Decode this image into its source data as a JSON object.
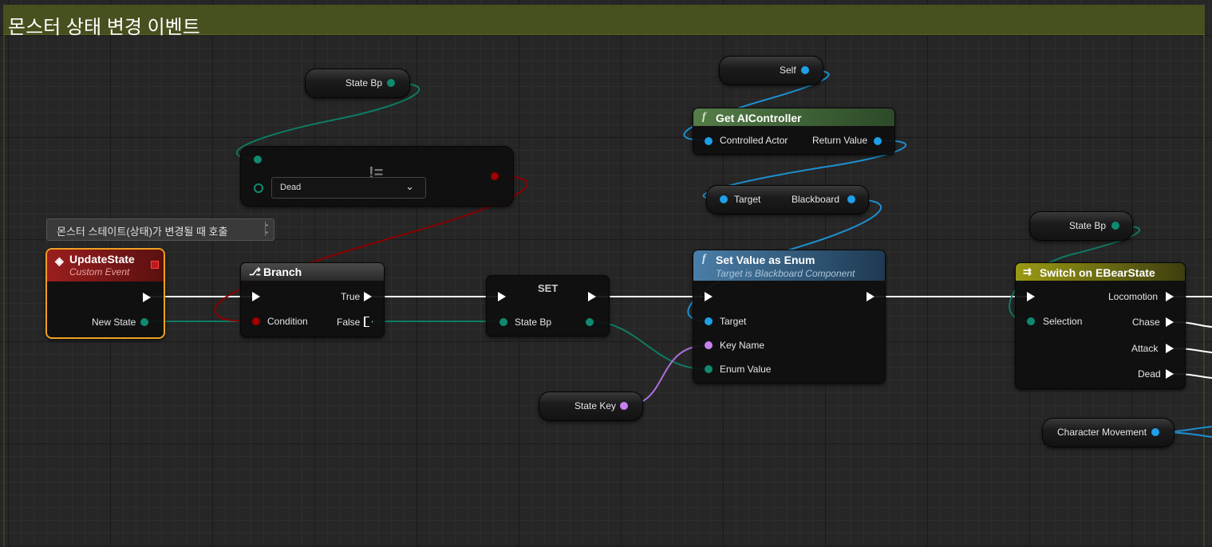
{
  "comment": {
    "title": "몬스터 상태 변경 이벤트"
  },
  "tooltip": {
    "text": "몬스터 스테이트(상태)가 변경될 때 호출"
  },
  "nodes": {
    "update_state": {
      "title": "UpdateState",
      "subtitle": "Custom Event",
      "output_pin": "New State"
    },
    "branch": {
      "title": "Branch",
      "condition": "Condition",
      "true_pin": "True",
      "false_pin": "False"
    },
    "set": {
      "title": "SET",
      "pin": "State Bp"
    },
    "equals": {
      "operator": "!=",
      "dropdown_value": "Dead"
    },
    "state_bp_var_1": {
      "label": "State Bp"
    },
    "self_var": {
      "label": "Self"
    },
    "get_ai_controller": {
      "title": "Get AIController",
      "input_pin": "Controlled Actor",
      "output_pin": "Return Value"
    },
    "blackboard": {
      "input_pin": "Target",
      "output_pin": "Blackboard"
    },
    "set_value_as_enum": {
      "title": "Set Value as Enum",
      "subtitle": "Target is Blackboard Component",
      "target_pin": "Target",
      "key_name_pin": "Key Name",
      "enum_value_pin": "Enum Value"
    },
    "state_key_var": {
      "label": "State Key"
    },
    "state_bp_var_2": {
      "label": "State Bp"
    },
    "switch": {
      "title": "Switch on EBearState",
      "selection_pin": "Selection",
      "outputs": [
        "Locomotion",
        "Chase",
        "Attack",
        "Dead"
      ]
    },
    "character_movement_var": {
      "label": "Character Movement"
    }
  },
  "colors": {
    "event_header": "#8c1a1a",
    "function_green": "#4f7a43",
    "function_blue": "#3f6a8c",
    "switch_header": "#8a8a12",
    "selected_outline": "#f0a020",
    "byte_pin": "#0f8a70",
    "object_pin": "#1ea0e8",
    "name_pin": "#c880f0",
    "bool_pin": "#a00000",
    "comment": "#47501f"
  },
  "icons": [
    "event-diamond-icon",
    "branch-icon",
    "function-icon",
    "switch-icon",
    "exec-pin-icon"
  ]
}
